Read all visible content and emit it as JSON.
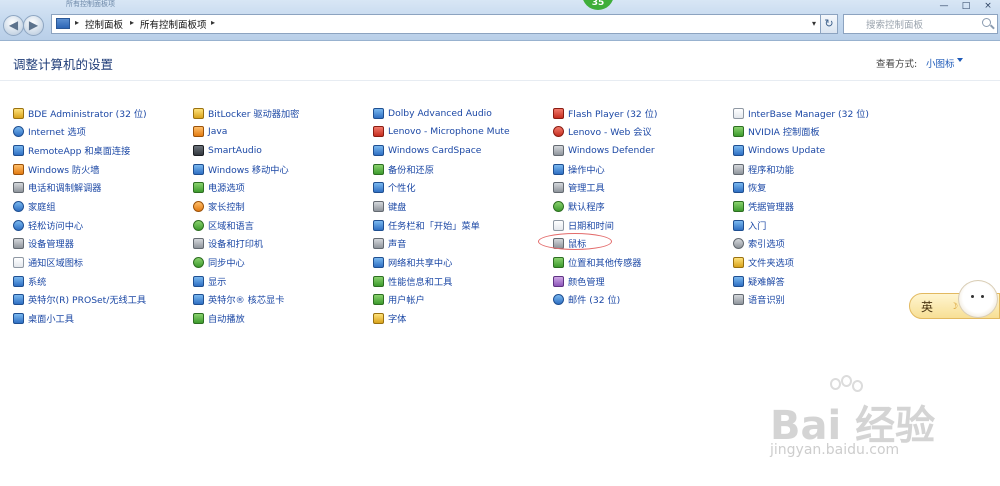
{
  "window": {
    "title": "所有控制面板项",
    "badge": "35",
    "controls": {
      "minimize": "—",
      "maximize": "□",
      "close": "×"
    }
  },
  "address_bar": {
    "crumbs": [
      "控制面板",
      "所有控制面板项"
    ],
    "separator": "▸",
    "dropdown": "▾",
    "refresh": "↻",
    "search_placeholder": "搜索控制面板"
  },
  "header": {
    "title": "调整计算机的设置",
    "view_by_label": "查看方式:",
    "view_by_value": "小图标"
  },
  "columns": [
    [
      {
        "label": "BDE Administrator (32 位)",
        "icon": "database-icon"
      },
      {
        "label": "Internet 选项",
        "icon": "internet-icon"
      },
      {
        "label": "RemoteApp 和桌面连接",
        "icon": "remote-desktop-icon"
      },
      {
        "label": "Windows 防火墙",
        "icon": "firewall-icon"
      },
      {
        "label": "电话和调制解调器",
        "icon": "phone-modem-icon"
      },
      {
        "label": "家庭组",
        "icon": "homegroup-icon"
      },
      {
        "label": "轻松访问中心",
        "icon": "ease-of-access-icon"
      },
      {
        "label": "设备管理器",
        "icon": "device-manager-icon"
      },
      {
        "label": "通知区域图标",
        "icon": "notification-area-icon"
      },
      {
        "label": "系统",
        "icon": "system-icon"
      },
      {
        "label": "英特尔(R) PROSet/无线工具",
        "icon": "wireless-tools-icon"
      },
      {
        "label": "桌面小工具",
        "icon": "desktop-gadgets-icon"
      }
    ],
    [
      {
        "label": "BitLocker 驱动器加密",
        "icon": "bitlocker-icon"
      },
      {
        "label": "Java",
        "icon": "java-icon"
      },
      {
        "label": "SmartAudio",
        "icon": "smartaudio-icon"
      },
      {
        "label": "Windows 移动中心",
        "icon": "mobility-center-icon"
      },
      {
        "label": "电源选项",
        "icon": "power-options-icon"
      },
      {
        "label": "家长控制",
        "icon": "parental-controls-icon"
      },
      {
        "label": "区域和语言",
        "icon": "region-language-icon"
      },
      {
        "label": "设备和打印机",
        "icon": "devices-printers-icon"
      },
      {
        "label": "同步中心",
        "icon": "sync-center-icon"
      },
      {
        "label": "显示",
        "icon": "display-icon"
      },
      {
        "label": "英特尔® 核芯显卡",
        "icon": "intel-graphics-icon"
      },
      {
        "label": "自动播放",
        "icon": "autoplay-icon"
      }
    ],
    [
      {
        "label": "Dolby Advanced Audio",
        "icon": "dolby-icon"
      },
      {
        "label": "Lenovo - Microphone Mute",
        "icon": "microphone-mute-icon"
      },
      {
        "label": "Windows CardSpace",
        "icon": "cardspace-icon"
      },
      {
        "label": "备份和还原",
        "icon": "backup-restore-icon"
      },
      {
        "label": "个性化",
        "icon": "personalization-icon"
      },
      {
        "label": "键盘",
        "icon": "keyboard-icon"
      },
      {
        "label": "任务栏和「开始」菜单",
        "icon": "taskbar-icon"
      },
      {
        "label": "声音",
        "icon": "sound-icon"
      },
      {
        "label": "网络和共享中心",
        "icon": "network-icon"
      },
      {
        "label": "性能信息和工具",
        "icon": "performance-icon"
      },
      {
        "label": "用户帐户",
        "icon": "user-accounts-icon"
      },
      {
        "label": "字体",
        "icon": "fonts-icon"
      }
    ],
    [
      {
        "label": "Flash Player (32 位)",
        "icon": "flash-player-icon"
      },
      {
        "label": "Lenovo - Web 会议",
        "icon": "web-conference-icon"
      },
      {
        "label": "Windows Defender",
        "icon": "defender-icon"
      },
      {
        "label": "操作中心",
        "icon": "action-center-icon"
      },
      {
        "label": "管理工具",
        "icon": "admin-tools-icon"
      },
      {
        "label": "默认程序",
        "icon": "default-programs-icon"
      },
      {
        "label": "日期和时间",
        "icon": "date-time-icon"
      },
      {
        "label": "鼠标",
        "icon": "mouse-icon"
      },
      {
        "label": "位置和其他传感器",
        "icon": "location-sensors-icon"
      },
      {
        "label": "颜色管理",
        "icon": "color-management-icon"
      },
      {
        "label": "邮件 (32 位)",
        "icon": "mail-icon"
      }
    ],
    [
      {
        "label": "InterBase Manager (32 位)",
        "icon": "interbase-icon"
      },
      {
        "label": "NVIDIA 控制面板",
        "icon": "nvidia-icon"
      },
      {
        "label": "Windows Update",
        "icon": "windows-update-icon"
      },
      {
        "label": "程序和功能",
        "icon": "programs-features-icon"
      },
      {
        "label": "恢复",
        "icon": "recovery-icon"
      },
      {
        "label": "凭据管理器",
        "icon": "credential-manager-icon"
      },
      {
        "label": "入门",
        "icon": "getting-started-icon"
      },
      {
        "label": "索引选项",
        "icon": "indexing-icon"
      },
      {
        "label": "文件夹选项",
        "icon": "folder-options-icon"
      },
      {
        "label": "疑难解答",
        "icon": "troubleshooting-icon"
      },
      {
        "label": "语音识别",
        "icon": "speech-recognition-icon"
      }
    ]
  ],
  "ime_widget": {
    "label": "英"
  },
  "watermark": {
    "text": "Bai 经验",
    "subtext": "jingyan.baidu.com"
  }
}
